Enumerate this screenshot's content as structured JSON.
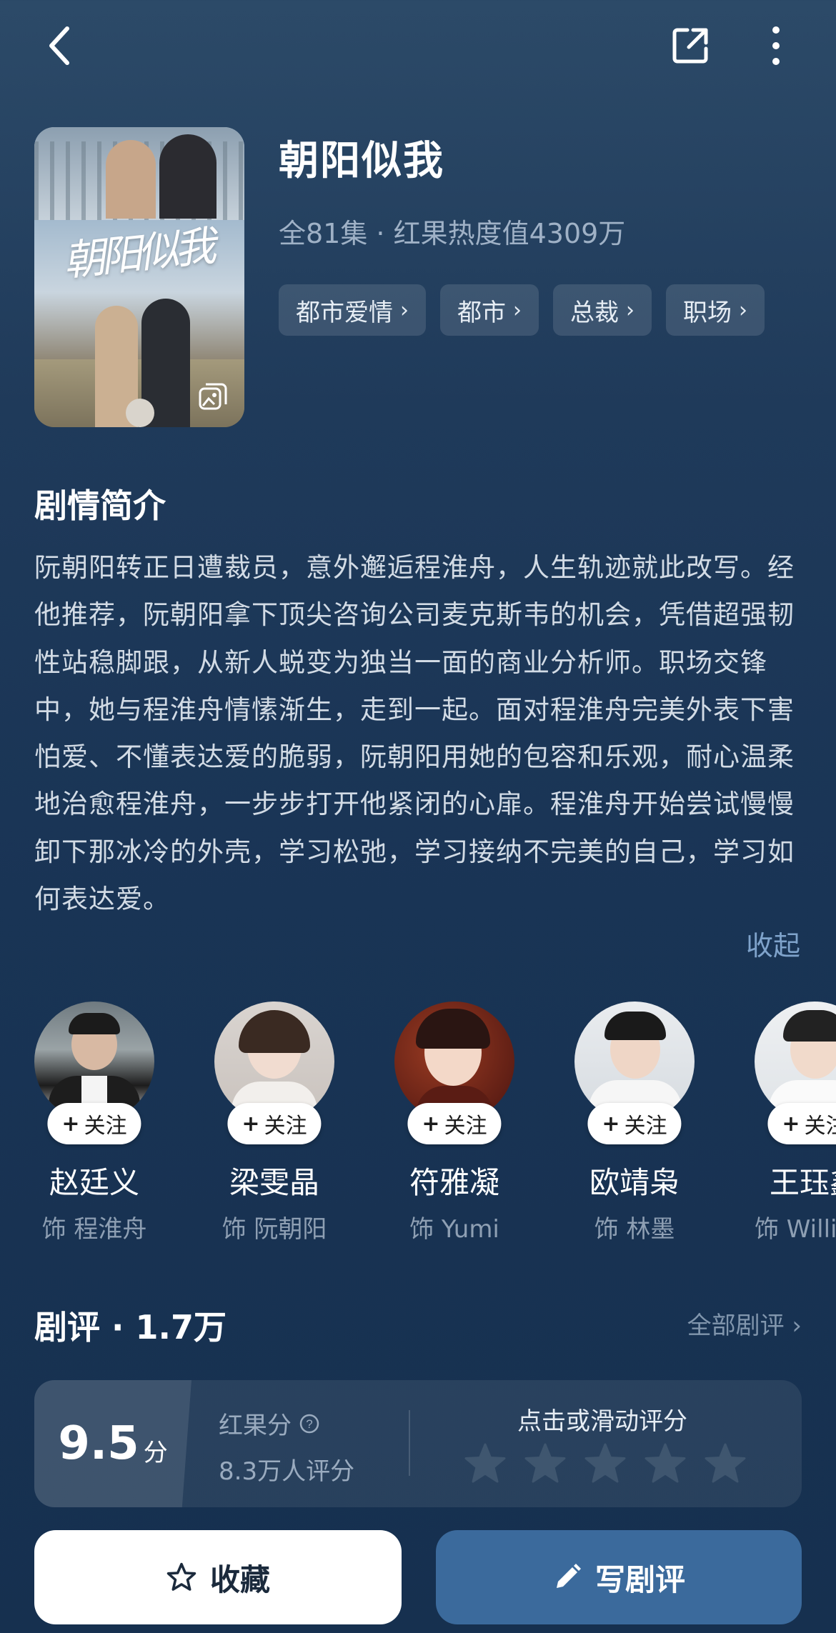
{
  "header": {
    "back_icon": "back-icon",
    "share_icon": "share-icon",
    "more_icon": "more-icon"
  },
  "show": {
    "title": "朝阳似我",
    "poster_title_art": "朝阳似我",
    "meta": "全81集 · 红果热度值4309万",
    "tags": [
      {
        "label": "都市爱情"
      },
      {
        "label": "都市"
      },
      {
        "label": "总裁"
      },
      {
        "label": "职场"
      }
    ]
  },
  "synopsis": {
    "title": "剧情简介",
    "text": "阮朝阳转正日遭裁员，意外邂逅程淮舟，人生轨迹就此改写。经他推荐，阮朝阳拿下顶尖咨询公司麦克斯韦的机会，凭借超强韧性站稳脚跟，从新人蜕变为独当一面的商业分析师。职场交锋中，她与程淮舟情愫渐生，走到一起。面对程淮舟完美外表下害怕爱、不懂表达爱的脆弱，阮朝阳用她的包容和乐观，耐心温柔地治愈程淮舟，一步步打开他紧闭的心扉。程淮舟开始尝试慢慢卸下那冰冷的外壳，学习松弛，学习接纳不完美的自己，学习如何表达爱。",
    "collapse_label": "收起"
  },
  "cast": [
    {
      "name": "赵廷义",
      "role": "饰 程淮舟",
      "follow": "关注"
    },
    {
      "name": "梁雯晶",
      "role": "饰 阮朝阳",
      "follow": "关注"
    },
    {
      "name": "符雅凝",
      "role": "饰 Yumi",
      "follow": "关注"
    },
    {
      "name": "欧靖枭",
      "role": "饰 林墨",
      "follow": "关注"
    },
    {
      "name": "王珏鑫",
      "role": "饰 William",
      "follow": "关注"
    }
  ],
  "reviews": {
    "title": "剧评 · 1.7万",
    "all_label": "全部剧评",
    "score": "9.5",
    "score_unit": "分",
    "score_label": "红果分",
    "rater_count": "8.3万人评分",
    "rate_prompt": "点击或滑动评分",
    "user_rating": 0,
    "max_rating": 5
  },
  "actions": {
    "collect_label": "收藏",
    "write_label": "写剧评"
  },
  "colors": {
    "accent": "#3b6a9c",
    "link": "#7fa3cb",
    "background": "#1f3a5a"
  }
}
